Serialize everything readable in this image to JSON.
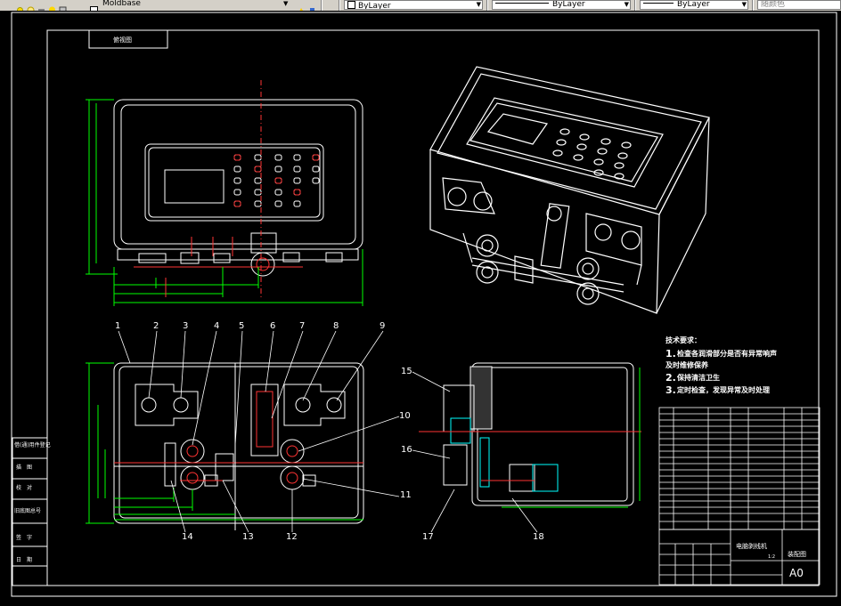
{
  "toolbar": {
    "layer_name": "Moldbase",
    "color_value": "ByLayer",
    "linetype_value": "ByLayer",
    "lineweight_value": "ByLayer",
    "plotstyle_value": "随颜色"
  },
  "drawing": {
    "top_view_label": "俯视图",
    "balloons": [
      "1",
      "2",
      "3",
      "4",
      "5",
      "6",
      "7",
      "8",
      "9",
      "10",
      "11",
      "12",
      "13",
      "14",
      "15",
      "16",
      "17",
      "18"
    ],
    "tech_notes": {
      "heading": "技术要求：",
      "item1_num": "1.",
      "item1_text": "检查各润滑部分是否有异常响声",
      "item1_cont": "及时维修保养",
      "item2_num": "2.",
      "item2_text": "保持清洁卫生",
      "item3_num": "3.",
      "item3_text": "定时检查，发现异常及时处理"
    },
    "sidebar_labels": [
      "借(通)用件登记",
      "描　图",
      "校　对",
      "旧底图总号",
      "签　字",
      "日　期"
    ],
    "title_block": {
      "drawing_name": "电脑剥线机",
      "scale": "1:2",
      "sheet_size": "A0",
      "designer": "装配图"
    }
  },
  "colors": {
    "canvas_background": "#000000",
    "border_line": "#ffffff",
    "dimension_line": "#00ff00",
    "hidden_line": "#ff3333",
    "centerline": "#ff3333",
    "motor_part": "#00ffff"
  }
}
